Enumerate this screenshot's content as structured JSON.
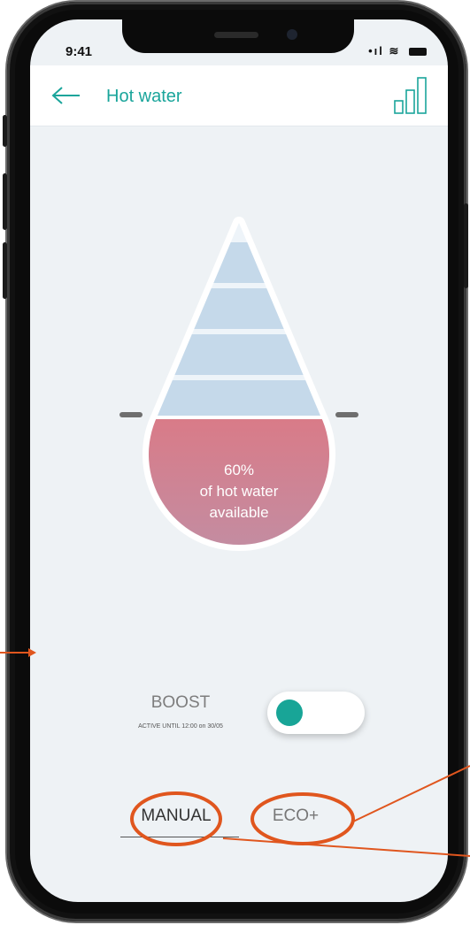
{
  "status_bar": {
    "time": "9:41",
    "signal": "•ıl",
    "wifi": "≋"
  },
  "header": {
    "title": "Hot water",
    "back_icon": "arrow-left-icon",
    "action_icon": "signal-bars-icon"
  },
  "tank": {
    "percentage_text": "60%",
    "line1": "of hot water",
    "line2": "available",
    "fill_fraction": 0.6,
    "cold_color": "#c5d9ea",
    "hot_color_top": "#d97b88",
    "hot_color_bottom": "#b29ab5"
  },
  "boost": {
    "label": "BOOST",
    "sub_label": "ACTIVE UNTIL 12:00 on 30/05",
    "toggle_color": "#18a597"
  },
  "modes": {
    "manual": "MANUAL",
    "eco": "ECO+"
  },
  "colors": {
    "accent": "#1aa59b",
    "annotation": "#e0561e"
  }
}
